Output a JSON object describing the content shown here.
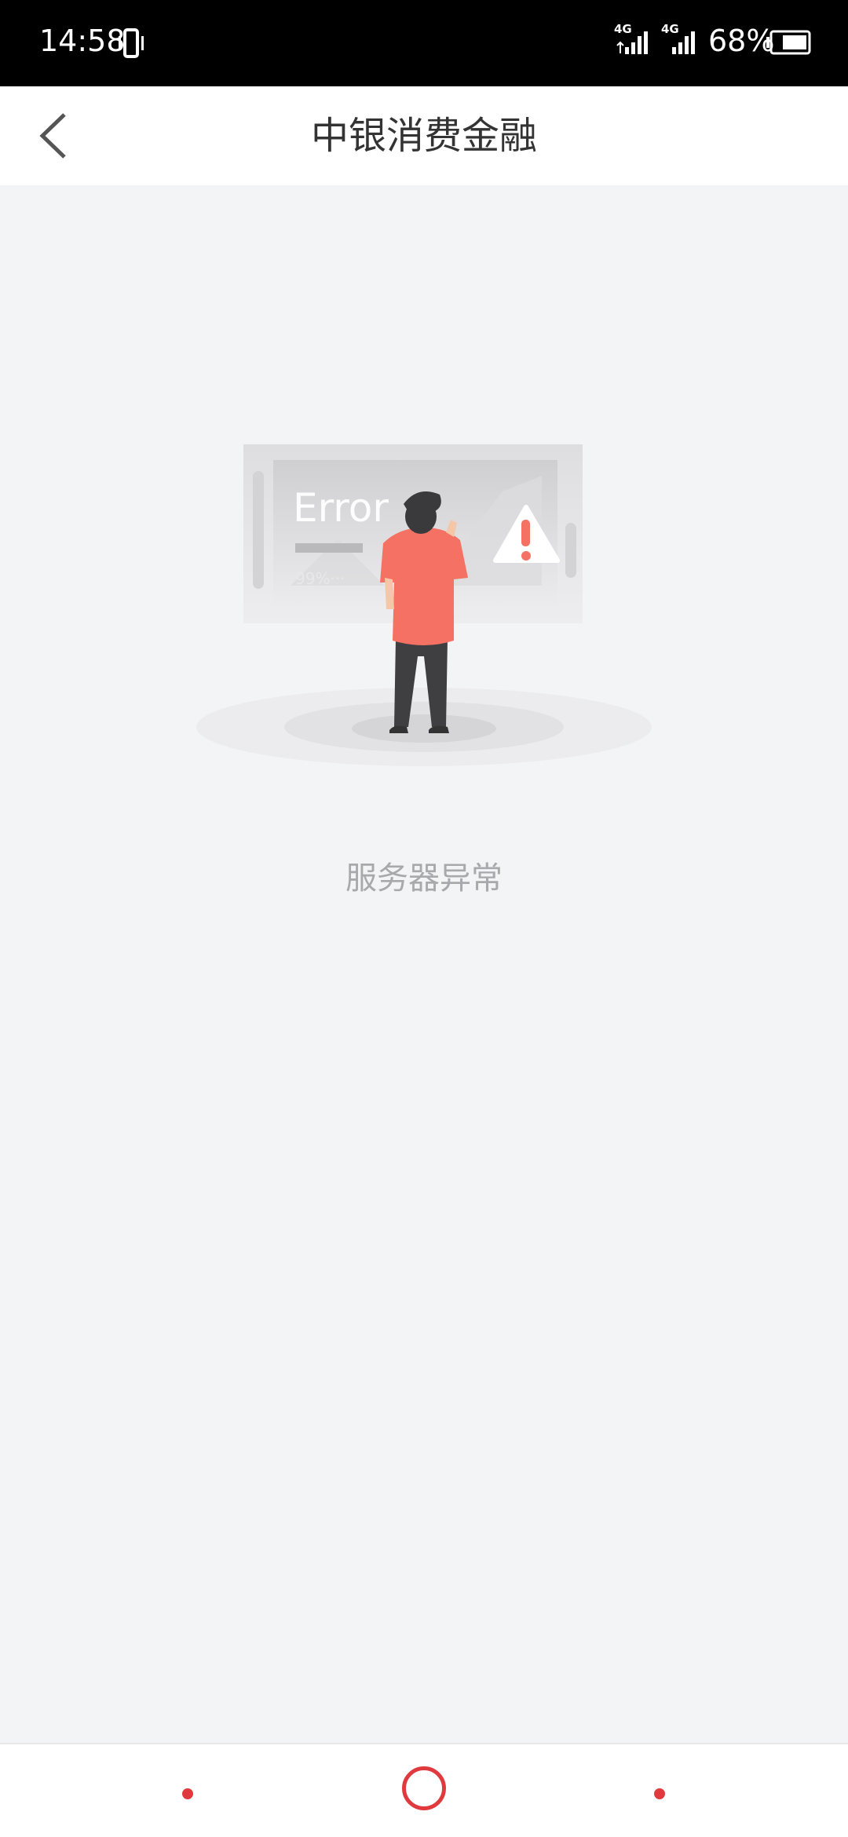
{
  "status_bar": {
    "time": "14:58",
    "network_type_1": "4G",
    "network_type_2": "4G",
    "battery_percent": "68%",
    "icons": [
      "vibrate-icon",
      "signal-icon",
      "signal-icon",
      "battery-icon"
    ]
  },
  "nav": {
    "title": "中银消费金融",
    "back_icon": "chevron-left-icon"
  },
  "illustration": {
    "screen_text": "Error",
    "progress_text": "99%···",
    "warning_icon": "warning-triangle-icon"
  },
  "message": "服务器异常",
  "system_nav": {
    "items": [
      "dot",
      "home-ring",
      "dot"
    ]
  },
  "colors": {
    "accent": "#e03a3e",
    "shirt": "#f47163",
    "background": "#f3f4f6"
  }
}
